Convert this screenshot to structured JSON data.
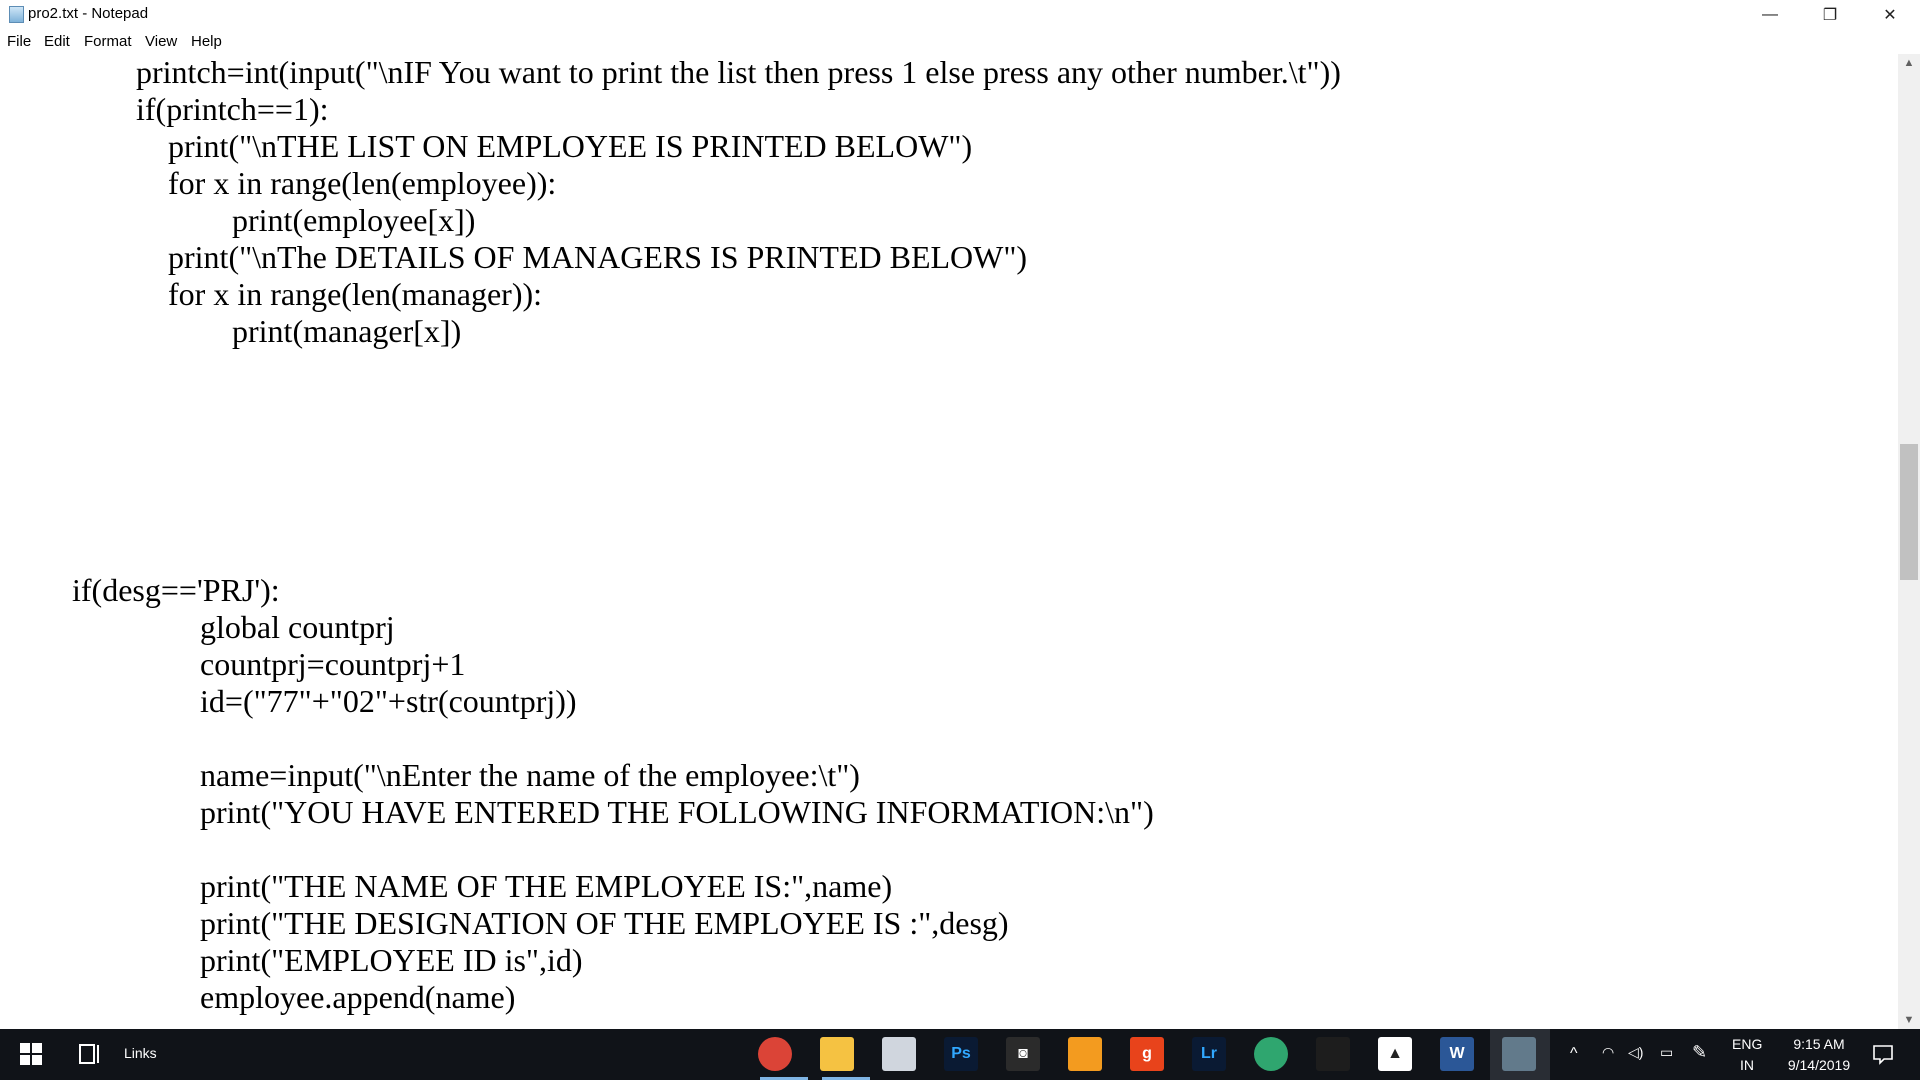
{
  "window": {
    "title": "pro2.txt - Notepad",
    "minimize_glyph": "—",
    "restore_glyph": "❐",
    "close_glyph": "✕"
  },
  "menu": [
    "File",
    "Edit",
    "Format",
    "View",
    "Help"
  ],
  "code_lines": [
    "printch=int(input(\"\\nIF You want to print the list then press 1 else press any other number.\\t\"))",
    "if(printch==1):",
    "print(\"\\nTHE LIST ON EMPLOYEE IS PRINTED BELOW\")",
    "for x in range(len(employee)):",
    "print(employee[x])",
    "print(\"\\nThe DETAILS OF MANAGERS IS PRINTED BELOW\")",
    "for x in range(len(manager)):",
    "print(manager[x])",
    "if(desg=='PRJ'):",
    "global countprj",
    "countprj=countprj+1",
    "id=(\"77\"+\"02\"+str(countprj))",
    "name=input(\"\\nEnter the name of the employee:\\t\")",
    "print(\"YOU HAVE ENTERED THE FOLLOWING INFORMATION:\\n\")",
    "print(\"THE NAME OF THE EMPLOYEE IS:\",name)",
    "print(\"THE DESIGNATION OF THE EMPLOYEE IS :\",desg)",
    "print(\"EMPLOYEE ID is\",id)",
    "employee.append(name)"
  ],
  "taskbar": {
    "links_label": "Links",
    "apps": [
      {
        "name": "chrome-icon",
        "glyph": "",
        "bg": "#db4437"
      },
      {
        "name": "file-explorer-icon",
        "glyph": "",
        "bg": "#f5c242"
      },
      {
        "name": "mail-icon",
        "glyph": "",
        "bg": "#d0d6de"
      },
      {
        "name": "photoshop-icon",
        "glyph": "Ps",
        "bg": "#0a1a33"
      },
      {
        "name": "app-icon",
        "glyph": "◙",
        "bg": "#2b2b2b"
      },
      {
        "name": "office-icon",
        "glyph": "",
        "bg": "#f39b1f"
      },
      {
        "name": "g-app-icon",
        "glyph": "g",
        "bg": "#e8431b"
      },
      {
        "name": "lightroom-icon",
        "glyph": "Lr",
        "bg": "#0a1a33"
      },
      {
        "name": "browser-icon",
        "glyph": "",
        "bg": "#2fa66f"
      },
      {
        "name": "terminal-icon",
        "glyph": "",
        "bg": "#1d1d1d"
      },
      {
        "name": "photos-icon",
        "glyph": "▲",
        "bg": "#ffffff"
      },
      {
        "name": "word-icon",
        "glyph": "W",
        "bg": "#2b5797"
      },
      {
        "name": "notepad-icon",
        "glyph": "",
        "bg": "#9fd1f0"
      }
    ],
    "tray": {
      "lang_top": "ENG",
      "lang_bottom": "IN",
      "time": "9:15 AM",
      "date": "9/14/2019"
    }
  },
  "colors": {
    "taskbar_bg": "#101318",
    "active_underline": "#7fb4e3",
    "scrollbar_thumb": "#c1c1c1"
  }
}
